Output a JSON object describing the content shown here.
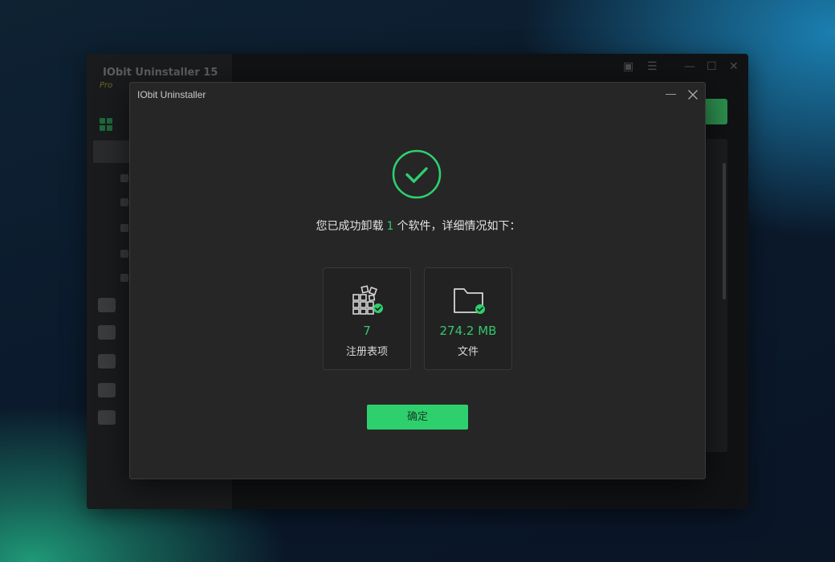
{
  "background_app": {
    "title": "IObit Uninstaller 15",
    "edition": "Pro"
  },
  "dialog": {
    "title": "IObit Uninstaller",
    "message_prefix": "您已成功卸载",
    "uninstalled_count": "1",
    "message_suffix": "个软件，详细情况如下：",
    "cards": {
      "registry": {
        "value": "7",
        "label": "注册表项",
        "icon": "registry-grid-check-icon"
      },
      "files": {
        "value": "274.2 MB",
        "label": "文件",
        "icon": "folder-check-icon"
      }
    },
    "ok_label": "确定"
  },
  "colors": {
    "accent_green": "#2ed06e",
    "text_green": "#35c76e",
    "dialog_bg": "#262626"
  }
}
